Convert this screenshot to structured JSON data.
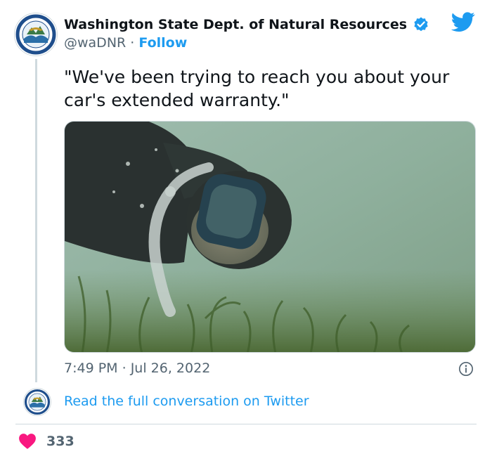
{
  "author": {
    "name": "Washington State Dept. of Natural Resources",
    "handle": "@waDNR",
    "separator": "·",
    "follow_label": "Follow",
    "verified": true,
    "avatar_icon": "dnr-seal-icon"
  },
  "tweet": {
    "text": "\"We've been trying to reach you about your car's extended warranty.\"",
    "time": "7:49 PM",
    "date_separator": "·",
    "date": "Jul 26, 2022"
  },
  "conversation": {
    "link_label": "Read the full conversation on Twitter"
  },
  "engagement": {
    "likes": "333"
  },
  "colors": {
    "accent": "#1d9bf0",
    "heart": "#f91880",
    "muted": "#536471",
    "border": "#cfd9de",
    "water": "#8fb0a0"
  },
  "icons": [
    "twitter-bird-icon",
    "verified-badge-icon",
    "info-icon",
    "heart-icon",
    "dnr-seal-icon"
  ]
}
